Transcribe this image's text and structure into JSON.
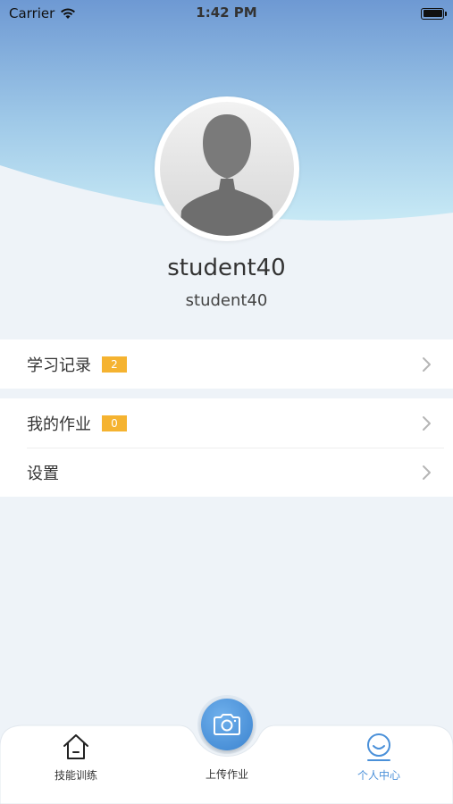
{
  "status_bar": {
    "carrier": "Carrier",
    "time": "1:42 PM"
  },
  "profile": {
    "username": "student40",
    "account": "student40"
  },
  "menu": {
    "study_records": {
      "label": "学习记录",
      "badge": "2"
    },
    "my_homework": {
      "label": "我的作业",
      "badge": "0"
    },
    "settings": {
      "label": "设置"
    }
  },
  "tabbar": {
    "skills": "技能训练",
    "upload": "上传作业",
    "profile": "个人中心"
  },
  "colors": {
    "accent": "#4a90d9",
    "badge": "#f5b330",
    "header_top": "#6e99d3",
    "header_bottom": "#c3e6f4",
    "page_bg": "#eef3f8"
  },
  "icons": {
    "wifi": "wifi-icon",
    "battery": "battery-icon",
    "avatar": "avatar-placeholder",
    "chevron": "chevron-right-icon",
    "home": "home-icon",
    "camera": "camera-icon",
    "smile": "smile-icon"
  }
}
